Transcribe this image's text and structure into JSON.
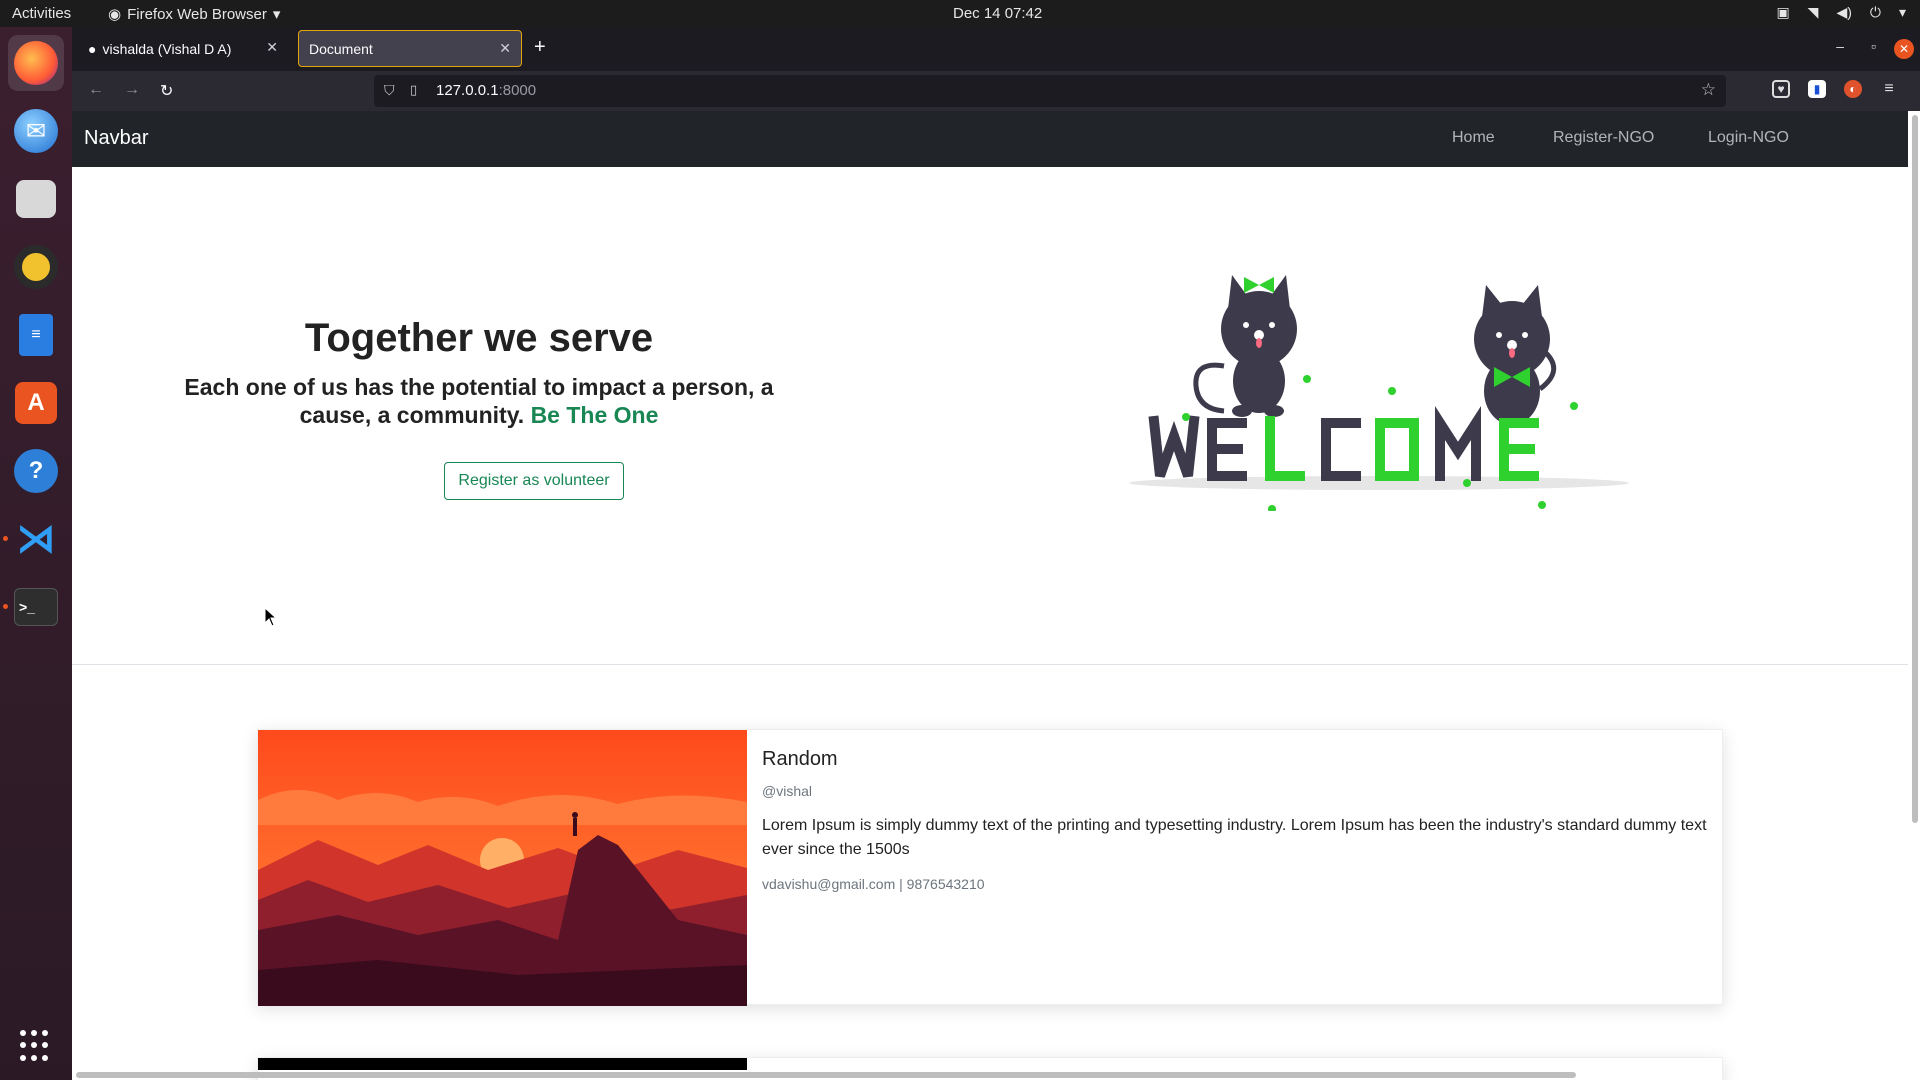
{
  "topbar": {
    "activities": "Activities",
    "app_menu": "Firefox Web Browser",
    "clock": "Dec 14  07:42"
  },
  "dock": {
    "items": [
      "firefox-icon",
      "thunderbird-icon",
      "files-icon",
      "rhythmbox-icon",
      "libreoffice-writer-icon",
      "app-center-icon",
      "help-icon",
      "vscode-icon",
      "terminal-icon"
    ]
  },
  "browser": {
    "tabs": [
      {
        "label": "vishalda (Vishal D A)",
        "active": false
      },
      {
        "label": "Document",
        "active": true
      }
    ],
    "url_host": "127.0.0.1",
    "url_port": ":8000"
  },
  "site": {
    "brand": "Navbar",
    "nav": [
      "Home",
      "Register-NGO",
      "Login-NGO"
    ],
    "hero": {
      "title": "Together we serve",
      "text": "Each one of us has the potential to impact a person, a cause, a community.",
      "highlight": "Be The One",
      "button": "Register as volunteer"
    },
    "welcome_letters": "WELCOME",
    "cards": [
      {
        "title": "Random",
        "handle": "@vishal",
        "body": "Lorem Ipsum is simply dummy text of the printing and typesetting industry. Lorem Ipsum has been the industry's standard dummy text ever since the 1500s",
        "contact": "vdavishu@gmail.com | 9876543210"
      }
    ]
  },
  "colors": {
    "accent_green": "#198754",
    "welcome_green": "#2ed12e",
    "welcome_dark": "#3d3a4b",
    "navbar_bg": "#212529",
    "ubuntu_orange": "#e95420"
  }
}
